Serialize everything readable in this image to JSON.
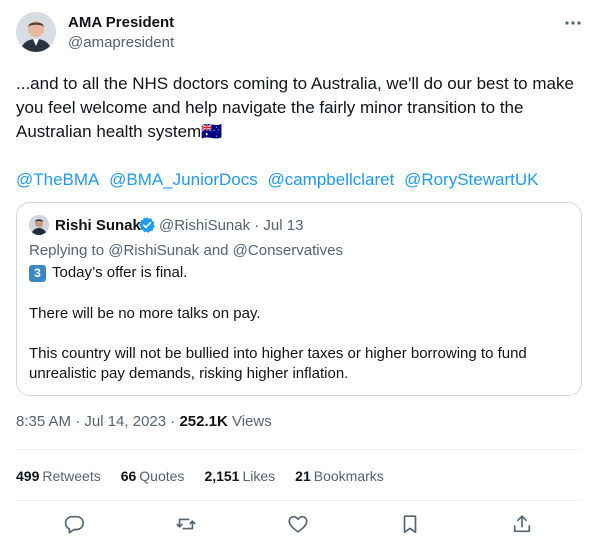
{
  "author": {
    "display_name": "AMA President",
    "handle": "@amapresident"
  },
  "tweet": {
    "lines": [
      "...and to all the NHS doctors coming to Australia, we'll do our best to make",
      "you feel welcome and help navigate the fairly minor transition to the",
      "Australian health system🇦🇺"
    ],
    "mentions": [
      "@TheBMA",
      "@BMA_JuniorDocs",
      "@campbellclaret",
      "@RoryStewartUK"
    ]
  },
  "quoted_tweet": {
    "display_name": "Rishi Sunak",
    "meta": "@RishiSunak · Jul 13",
    "replying_to": "Replying to @RishiSunak and @Conservatives",
    "keycap": "3",
    "line1": "Today’s offer is final.",
    "para2": "There will be no more talks on pay.",
    "para3_lines": [
      "This country will not be bullied into higher taxes or higher borrowing to fund",
      "unrealistic pay demands, risking higher inflation."
    ]
  },
  "timestamp": {
    "datetime": "8:35 AM · Jul 14, 2023 · ",
    "views_count": "252.1K",
    "views_label": " Views"
  },
  "stats": {
    "retweets_count": "499",
    "retweets_label": "Retweets",
    "quotes_count": "66",
    "quotes_label": "Quotes",
    "likes_count": "2,151",
    "likes_label": "Likes",
    "bookmarks_count": "21",
    "bookmarks_label": "Bookmarks"
  },
  "icons": {
    "more": "more-dots-icon",
    "verified": "verified-badge-icon",
    "reply": "reply-icon",
    "retweet": "retweet-icon",
    "like": "heart-icon",
    "bookmark": "bookmark-icon",
    "share": "share-icon"
  },
  "colors": {
    "link": "#1d9bf0",
    "secondary_text": "#536471",
    "verified": "#1d9bf0",
    "border": "#cfd9de"
  }
}
